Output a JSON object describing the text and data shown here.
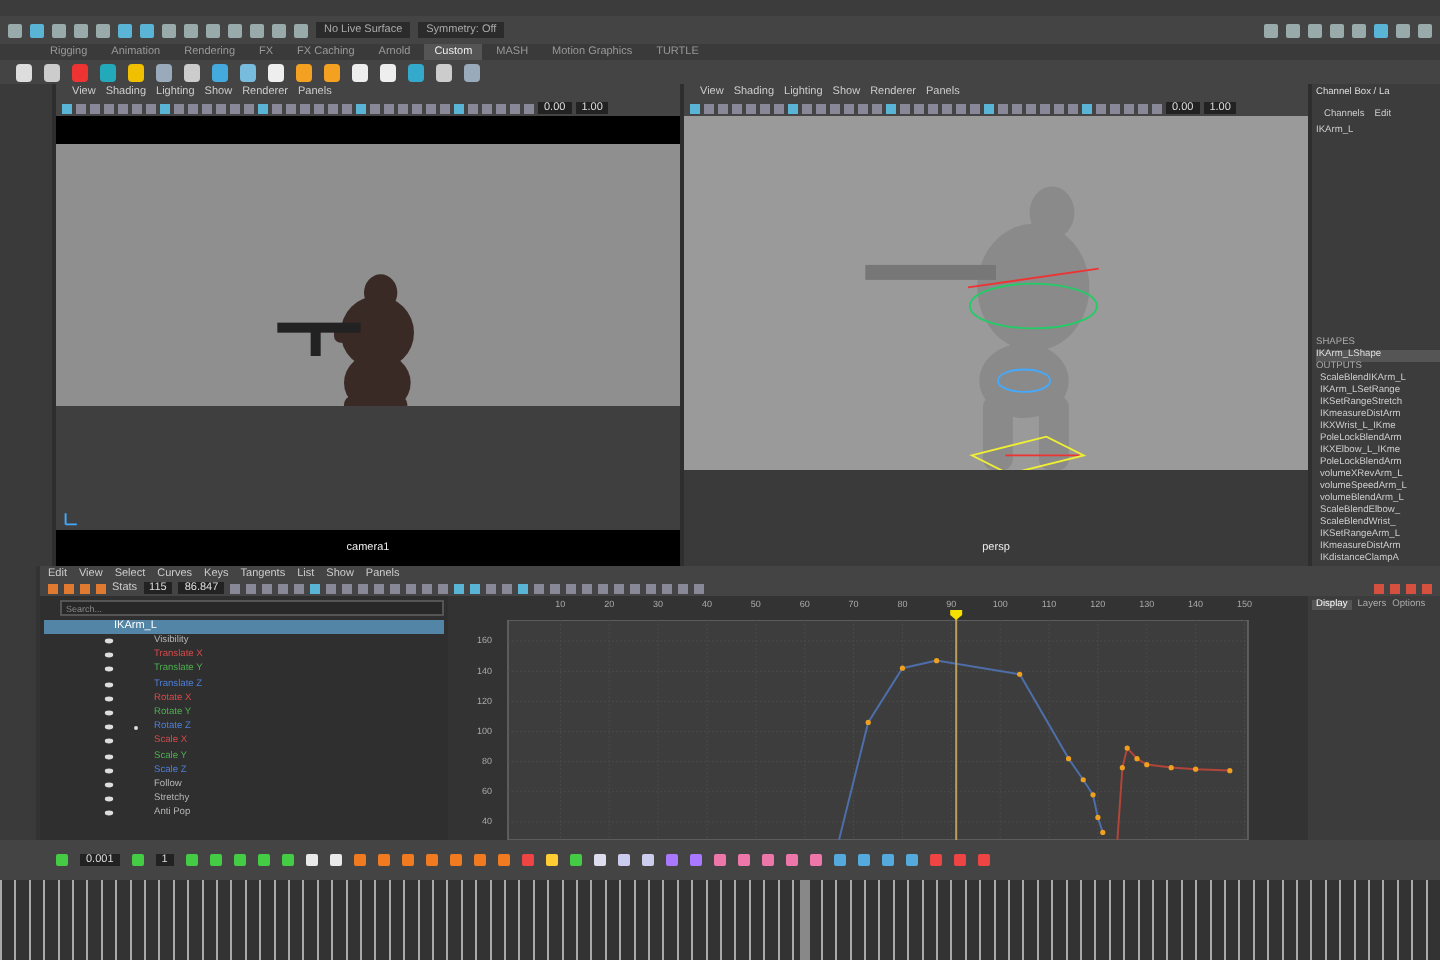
{
  "status_line": {
    "live_surface": "No Live Surface",
    "symmetry": "Symmetry: Off"
  },
  "shelf": {
    "tabs": [
      {
        "label": "Rigging",
        "selected": false
      },
      {
        "label": "Animation",
        "selected": false
      },
      {
        "label": "Rendering",
        "selected": false
      },
      {
        "label": "FX",
        "selected": false
      },
      {
        "label": "FX Caching",
        "selected": false
      },
      {
        "label": "Arnold",
        "selected": false
      },
      {
        "label": "Custom",
        "selected": true
      },
      {
        "label": "MASH",
        "selected": false
      },
      {
        "label": "Motion Graphics",
        "selected": false
      },
      {
        "label": "TURTLE",
        "selected": false
      }
    ]
  },
  "viewports": [
    {
      "kind": "render",
      "menu": [
        "View",
        "Shading",
        "Lighting",
        "Show",
        "Renderer",
        "Panels"
      ],
      "fields": [
        "0.00",
        "1.00"
      ],
      "camera": "camera1"
    },
    {
      "kind": "rig",
      "menu": [
        "View",
        "Shading",
        "Lighting",
        "Show",
        "Renderer",
        "Panels"
      ],
      "fields": [
        "0.00",
        "1.00"
      ],
      "camera": "persp"
    }
  ],
  "channel_box": {
    "title": "Channel Box / La",
    "menu": [
      "Channels",
      "Edit"
    ],
    "node": "IKArm_L",
    "shapes_heading": "SHAPES",
    "shape": "IKArm_LShape",
    "outputs_heading": "OUTPUTS",
    "outputs": [
      "ScaleBlendIKArm_L",
      "IKArm_LSetRange",
      "IKSetRangeStretch",
      "IKmeasureDistArm",
      "IKXWrist_L_IKme",
      "PoleLockBlendArm",
      "IKXElbow_L_IKme",
      "PoleLockBlendArm",
      "volumeXRevArm_L",
      "volumeSpeedArm_L",
      "volumeBlendArm_L",
      "ScaleBlendElbow_",
      "ScaleBlendWrist_",
      "IKSetRangeArm_L",
      "IKmeasureDistArm",
      "IKdistanceClampA"
    ],
    "tabs": [
      {
        "label": "Display",
        "selected": true
      },
      {
        "label": "Layers",
        "selected": false
      },
      {
        "label": "Options",
        "selected": false
      }
    ]
  },
  "graph_editor": {
    "menu": [
      "Edit",
      "View",
      "Select",
      "Curves",
      "Keys",
      "Tangents",
      "List",
      "Show",
      "Panels"
    ],
    "stats_label": "Stats",
    "stats": [
      "115",
      "86.847"
    ],
    "search": {
      "placeholder": "Search..."
    },
    "node": {
      "name": "IKArm_L",
      "selected": true
    },
    "channels": [
      {
        "name": "Visibility",
        "kind": "plain",
        "selected": false
      },
      {
        "name": "Translate X",
        "kind": "x",
        "selected": false
      },
      {
        "name": "Translate Y",
        "kind": "y",
        "selected": false
      },
      {
        "name": "Translate Z",
        "kind": "z",
        "selected": false
      },
      {
        "name": "Rotate X",
        "kind": "x",
        "selected": false
      },
      {
        "name": "Rotate Y",
        "kind": "y",
        "selected": false
      },
      {
        "name": "Rotate Z",
        "kind": "z",
        "selected": true
      },
      {
        "name": "Scale X",
        "kind": "x",
        "selected": false
      },
      {
        "name": "Scale Y",
        "kind": "y",
        "selected": false
      },
      {
        "name": "Scale Z",
        "kind": "z",
        "selected": false
      },
      {
        "name": "Follow",
        "kind": "plain",
        "selected": false
      },
      {
        "name": "Stretchy",
        "kind": "plain",
        "selected": false
      },
      {
        "name": "Anti Pop",
        "kind": "plain",
        "selected": false
      }
    ],
    "chart_data": {
      "type": "line",
      "x": [
        67,
        73,
        80,
        87,
        104,
        114,
        117,
        119,
        120,
        121,
        124,
        125,
        126,
        128,
        130,
        135,
        140,
        147
      ],
      "series": [
        {
          "color": "#4d6ea8",
          "values": [
            28,
            106,
            142,
            147,
            138,
            82,
            68,
            58,
            43,
            33,
            null,
            null,
            null,
            null,
            null,
            null,
            null,
            null
          ]
        },
        {
          "color": "#b0453a",
          "values": [
            null,
            null,
            null,
            null,
            null,
            null,
            null,
            null,
            null,
            null,
            28,
            76,
            89,
            82,
            78,
            76,
            75,
            74
          ]
        }
      ],
      "xlim": [
        -13,
        163
      ],
      "ylim": [
        28,
        174
      ],
      "ref_lines": [
        {
          "axis": "x",
          "value": 91
        }
      ],
      "xticks": [
        10,
        20,
        30,
        40,
        50,
        60,
        70,
        80,
        90,
        100,
        110,
        120,
        130,
        140,
        150
      ],
      "yticks": [
        40,
        60,
        80,
        100,
        120,
        140,
        160
      ],
      "grid": true
    }
  },
  "time_slider": {
    "fields": [
      "0.001",
      "1"
    ],
    "level": 0.555
  }
}
